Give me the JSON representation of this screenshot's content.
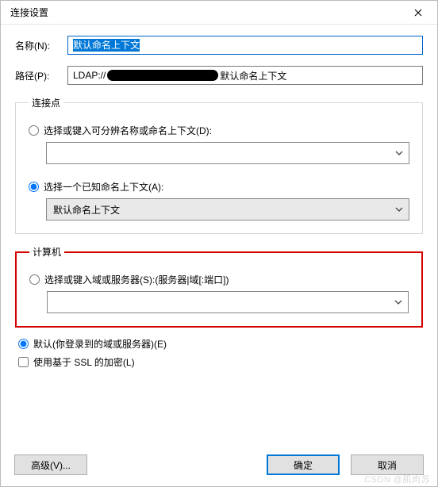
{
  "window": {
    "title": "连接设置"
  },
  "fields": {
    "name_label": "名称(N):",
    "name_value": "默认命名上下文",
    "path_label": "路径(P):",
    "path_prefix": "LDAP://",
    "path_suffix": "默认命名上下文"
  },
  "connection_point": {
    "legend": "连接点",
    "radio_dn": "选择或键入可分辨名称或命名上下文(D):",
    "dn_value": "",
    "radio_known": "选择一个已知命名上下文(A):",
    "known_value": "默认命名上下文",
    "selected": "known"
  },
  "computer": {
    "legend": "计算机",
    "radio_server": "选择或键入域或服务器(S):(服务器|域[:端口])",
    "server_value": "",
    "radio_default": "默认(你登录到的域或服务器)(E)",
    "ssl_label": "使用基于 SSL 的加密(L)",
    "ssl_checked": false,
    "selected": "default"
  },
  "buttons": {
    "advanced": "高级(V)...",
    "ok": "确定",
    "cancel": "取消"
  },
  "watermark": "CSDN @肌肉苏"
}
